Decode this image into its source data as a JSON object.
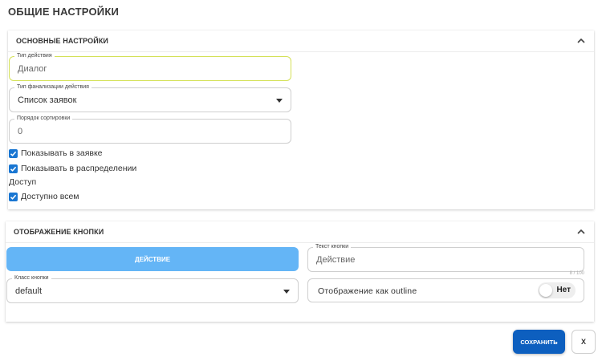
{
  "page": {
    "title": "ОБЩИЕ НАСТРОЙКИ"
  },
  "main_settings": {
    "title": "ОСНОВНЫЕ НАСТРОЙКИ",
    "action_type": {
      "label": "Тип действия",
      "value": "Диалог"
    },
    "finalization_type": {
      "label": "Тип фанализации действия",
      "value": "Список заявок"
    },
    "sort_order": {
      "label": "Порядок сортировки",
      "value": "0"
    },
    "show_in_request": {
      "label": "Показывать в заявке",
      "checked": true
    },
    "show_in_distribution": {
      "label": "Показывать в распределении",
      "checked": true
    },
    "access_title": "Доступ",
    "available_to_all": {
      "label": "Доступно всем",
      "checked": true
    }
  },
  "button_display": {
    "title": "ОТОБРАЖЕНИЕ КНОПКИ",
    "preview_label": "ДЕЙСТВИЕ",
    "button_text": {
      "label": "Текст кнопки",
      "placeholder": "Действие",
      "counter": "8 / 100"
    },
    "button_class": {
      "label": "Класс кнопки",
      "value": "default"
    },
    "outline": {
      "label": "Отображение как outline",
      "toggle_label": "Нет",
      "enabled": false
    }
  },
  "footer": {
    "save_label": "СОХРАНИТЬ",
    "close_label": "X"
  },
  "colors": {
    "accent": "#0d5fbf",
    "preview_button": "#64b5f6",
    "checkbox": "#1976d2",
    "focus_border": "#d4e157"
  }
}
